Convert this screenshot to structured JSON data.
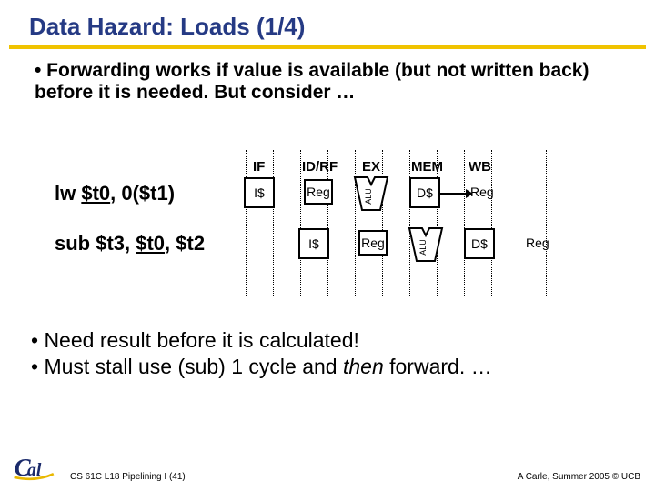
{
  "title": "Data Hazard: Loads (1/4)",
  "bullets": {
    "b1": "• Forwarding works if value is available (but not written back) before it is needed. But consider …",
    "b2a": "• Need result before it is calculated!",
    "b2b": "• Must stall use (sub) 1 cycle and ",
    "b2b_then": "then",
    "b2b_tail": " forward. …"
  },
  "stages": {
    "if": "IF",
    "id": "ID/RF",
    "ex": "EX",
    "mem": "MEM",
    "wb": "WB"
  },
  "instr": {
    "lw_a": "lw ",
    "lw_reg": "$t0",
    "lw_b": ", 0($t1)",
    "sub_a": "sub $t3, ",
    "sub_reg": "$t0",
    "sub_b": ", $t2"
  },
  "boxes": {
    "icache": "I$",
    "reg": "Reg",
    "dcache": "D$",
    "alu": "ALU"
  },
  "footer": {
    "left": "CS 61C L18 Pipelining I (41)",
    "right": "A Carle, Summer 2005 © UCB"
  }
}
